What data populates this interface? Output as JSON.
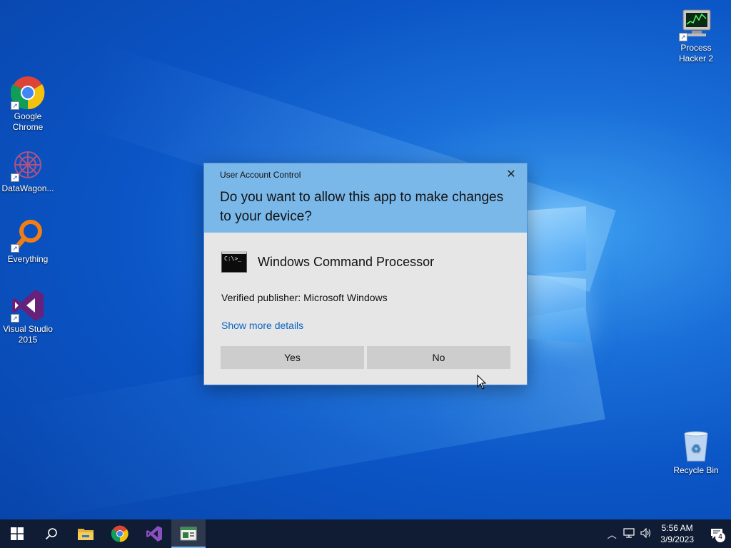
{
  "desktop": {
    "icons": [
      {
        "label": "Google Chrome",
        "icon": "chrome-icon"
      },
      {
        "label": "DataWagon...",
        "icon": "datawagon-icon"
      },
      {
        "label": "Everything",
        "icon": "everything-search-icon"
      },
      {
        "label": "Visual Studio 2015",
        "icon": "visual-studio-icon"
      },
      {
        "label": "Process Hacker 2",
        "icon": "process-hacker-icon"
      },
      {
        "label": "Recycle Bin",
        "icon": "recycle-bin-icon"
      }
    ]
  },
  "uac": {
    "title": "User Account Control",
    "question": "Do you want to allow this app to make changes to your device?",
    "app_name": "Windows Command Processor",
    "cmd_icon_text": "C:\\>_",
    "publisher": "Verified publisher: Microsoft Windows",
    "details_link": "Show more details",
    "yes_label": "Yes",
    "no_label": "No",
    "close_glyph": "✕"
  },
  "taskbar": {
    "pinned": [
      "start-button",
      "search-button",
      "file-explorer",
      "google-chrome",
      "visual-studio",
      "uac-consent-window"
    ],
    "time": "5:56 AM",
    "date": "3/9/2023",
    "notification_count": "4"
  },
  "colors": {
    "uac_header": "#7bb8ea",
    "uac_body": "#e6e6e6",
    "link": "#0a64c2",
    "taskbar": "#0f1c33"
  }
}
